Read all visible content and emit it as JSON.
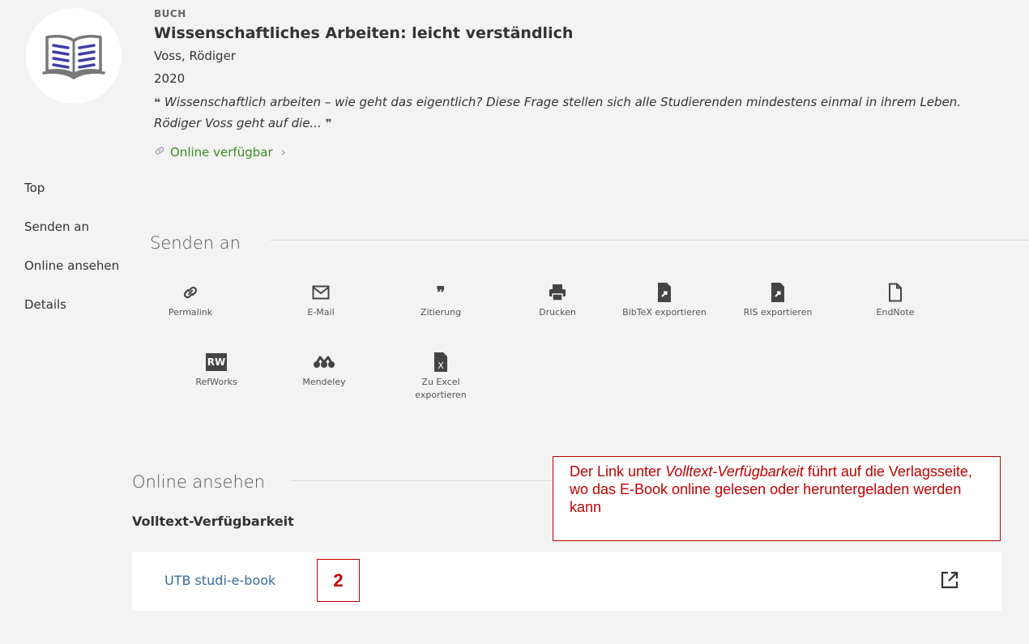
{
  "record": {
    "type": "BUCH",
    "title": "Wissenschaftliches Arbeiten: leicht verständlich",
    "author": "Voss, Rödiger",
    "year": "2020",
    "description": "Wissenschaftlich arbeiten – wie geht das eigentlich? Diese Frage stellen sich alle Studierenden mindestens einmal in ihrem Leben. Rödiger Voss geht auf die...",
    "availability": "Online verfügbar"
  },
  "sidenav": {
    "items": [
      {
        "label": "Top"
      },
      {
        "label": "Senden an"
      },
      {
        "label": "Online ansehen"
      },
      {
        "label": "Details"
      }
    ]
  },
  "send_to": {
    "heading": "Senden an",
    "actions": [
      {
        "label": "Permalink",
        "icon": "link-icon"
      },
      {
        "label": "E-Mail",
        "icon": "mail-icon"
      },
      {
        "label": "Zitierung",
        "icon": "quote-icon"
      },
      {
        "label": "Drucken",
        "icon": "print-icon"
      },
      {
        "label": "BibTeX exportieren",
        "icon": "export-file-icon"
      },
      {
        "label": "RIS exportieren",
        "icon": "export-file-icon"
      },
      {
        "label": "EndNote",
        "icon": "file-icon"
      },
      {
        "label": "RefWorks",
        "icon": "refworks-icon"
      },
      {
        "label": "Mendeley",
        "icon": "mendeley-icon"
      },
      {
        "label": "Zu Excel exportieren",
        "icon": "excel-icon"
      }
    ],
    "refworks_badge": "RW",
    "excel_badge": "X"
  },
  "online_view": {
    "heading": "Online ansehen",
    "subheading": "Volltext-Verfügbarkeit",
    "link_label": "UTB studi-e-book"
  },
  "annotation": {
    "marker": "2",
    "callout_prefix": "Der Link unter ",
    "callout_emphasis": "Volltext-Verfügbarkeit",
    "callout_suffix": " führt auf die Verlagsseite, wo das E-Book online gelesen oder heruntergeladen werden kann"
  }
}
